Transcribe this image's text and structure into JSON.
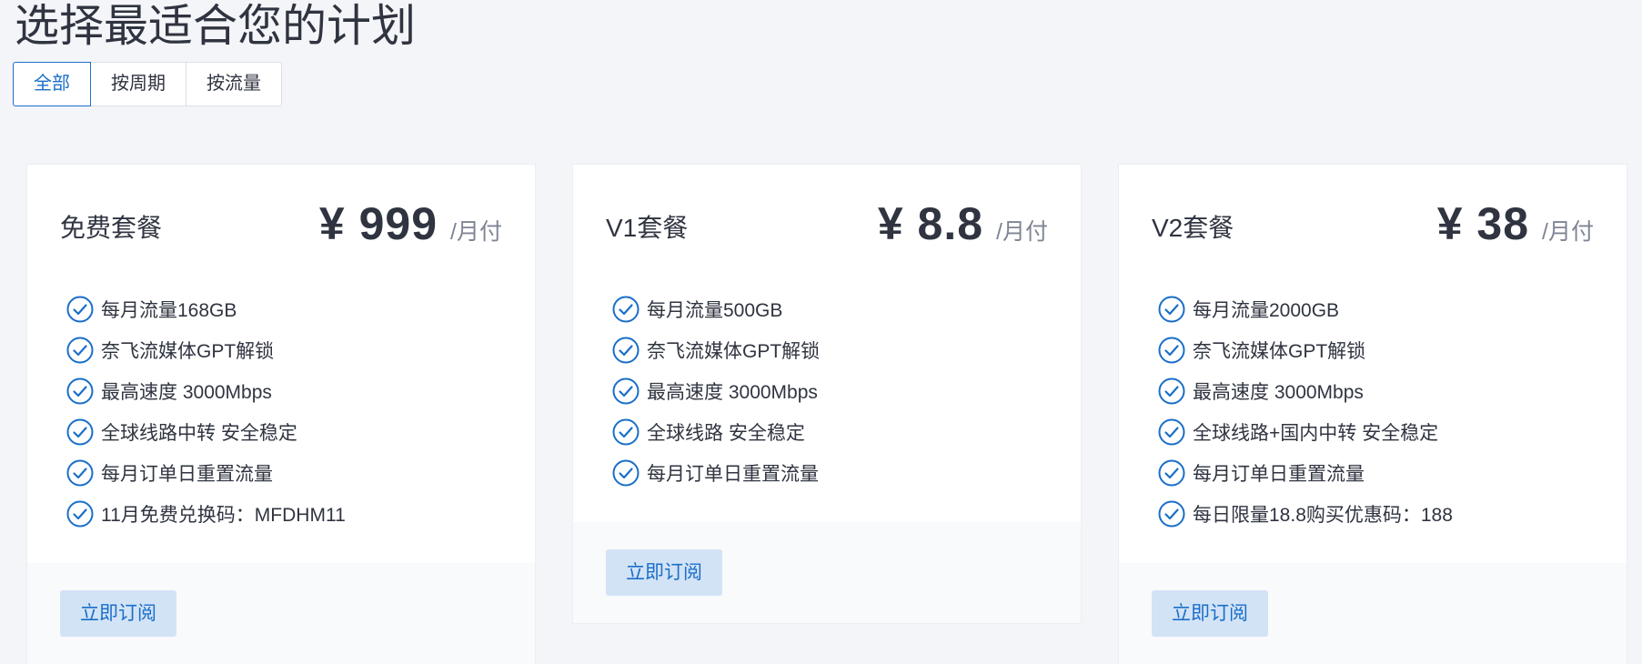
{
  "page": {
    "title": "选择最适合您的计划"
  },
  "tabs": [
    {
      "label": "全部",
      "active": true
    },
    {
      "label": "按周期",
      "active": false
    },
    {
      "label": "按流量",
      "active": false
    }
  ],
  "colors": {
    "accent": "#1a6fc9",
    "button_bg": "#d3e3f6",
    "page_bg": "#f4f5f9",
    "footer_bg": "#f9fafc"
  },
  "plans": [
    {
      "name": "免费套餐",
      "price": "¥ 999",
      "period": "/月付",
      "features": [
        "每月流量168GB",
        "奈飞流媒体GPT解锁",
        "最高速度 3000Mbps",
        "全球线路中转 安全稳定",
        "每月订单日重置流量",
        "11月免费兑换码：MFDHM11"
      ],
      "button": "立即订阅"
    },
    {
      "name": "V1套餐",
      "price": "¥ 8.8",
      "period": "/月付",
      "features": [
        "每月流量500GB",
        "奈飞流媒体GPT解锁",
        "最高速度 3000Mbps",
        "全球线路 安全稳定",
        "每月订单日重置流量"
      ],
      "button": "立即订阅"
    },
    {
      "name": "V2套餐",
      "price": "¥ 38",
      "period": "/月付",
      "features": [
        "每月流量2000GB",
        "奈飞流媒体GPT解锁",
        "最高速度 3000Mbps",
        "全球线路+国内中转 安全稳定",
        "每月订单日重置流量",
        "每日限量18.8购买优惠码：188"
      ],
      "button": "立即订阅"
    }
  ],
  "icons": {
    "feature": "check-circle-icon"
  }
}
